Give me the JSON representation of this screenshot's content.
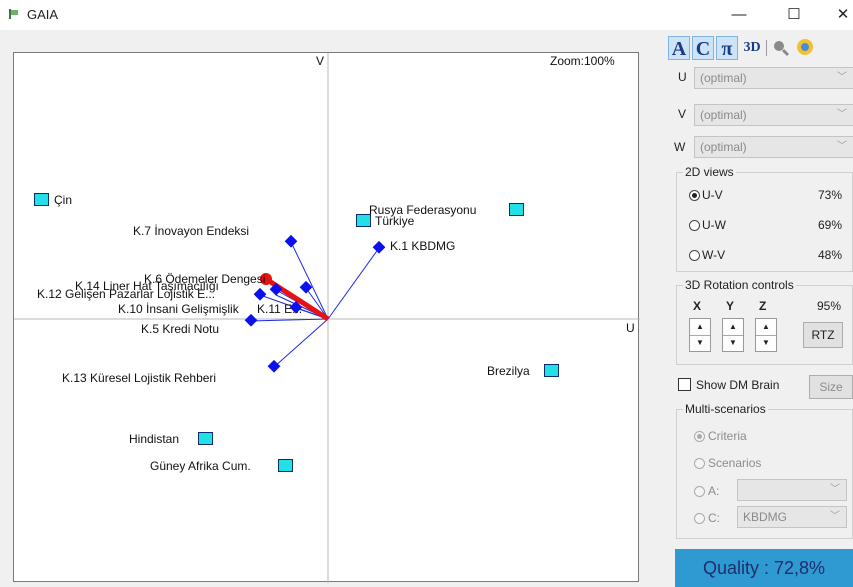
{
  "window": {
    "title": "GAIA",
    "minimize": "—",
    "maximize": "☐",
    "close": "✕"
  },
  "plot": {
    "v_axis_label": "V",
    "u_axis_label": "U",
    "zoom_text": "Zoom:100%",
    "criteria": [
      {
        "name": "K.1 KBDMG"
      },
      {
        "name": "K.5 Kredi Notu"
      },
      {
        "name": "K.6 Ödemeler Dengesi"
      },
      {
        "name": "K.7 İnovayon Endeksi"
      },
      {
        "name": "K.10 İnsani Gelişmişlik"
      },
      {
        "name": "K.11 E..."
      },
      {
        "name": "K.12 Gelişen Pazarlar Lojistik E..."
      },
      {
        "name": "K.13 Küresel Lojistik Rehberi"
      },
      {
        "name": "K.14 Liner Hat Taşımacılığı"
      }
    ],
    "alternatives": [
      {
        "name": "Çin"
      },
      {
        "name": "Rusya Federasyonu"
      },
      {
        "name": "Türkiye"
      },
      {
        "name": "Brezilya"
      },
      {
        "name": "Hindistan"
      },
      {
        "name": "Güney Afrika Cum."
      }
    ],
    "colors": {
      "criteria": "#0a10ee",
      "alternative": "#22e0e6",
      "decision_axis": "#e81010"
    }
  },
  "toolbar": {
    "a": "A",
    "c": "C",
    "pi": "π",
    "three_d": "3D",
    "zoom_icon": "magnifier-icon",
    "settings_icon": "color-wheel-icon"
  },
  "axes_select": {
    "u_label": "U",
    "u_value": "(optimal)",
    "v_label": "V",
    "v_value": "(optimal)",
    "w_label": "W",
    "w_value": "(optimal)"
  },
  "views_2d": {
    "title": "2D views",
    "items": [
      {
        "label": "U-V",
        "value": "73%",
        "selected": true
      },
      {
        "label": "U-W",
        "value": "69%",
        "selected": false
      },
      {
        "label": "W-V",
        "value": "48%",
        "selected": false
      }
    ]
  },
  "rotation": {
    "title": "3D Rotation controls",
    "x": "X",
    "y": "Y",
    "z": "Z",
    "value": "95%",
    "rtz": "RTZ"
  },
  "dm_brain": {
    "label": "Show DM Brain",
    "size_button": "Size"
  },
  "multi": {
    "title": "Multi-scenarios",
    "criteria": "Criteria",
    "scenarios": "Scenarios",
    "a_label": "A:",
    "c_label": "C:",
    "c_value": "KBDMG"
  },
  "quality": {
    "text": "Quality : 72,8%"
  }
}
